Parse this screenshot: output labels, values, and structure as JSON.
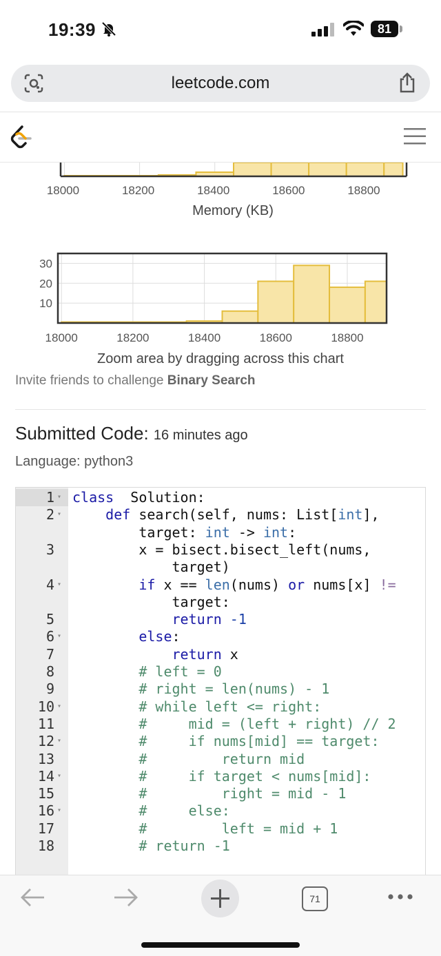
{
  "status_bar": {
    "time": "19:39",
    "battery": "81"
  },
  "browser": {
    "url": "leetcode.com",
    "tab_count": "71"
  },
  "memory_chart": {
    "x_ticks": [
      "18000",
      "18200",
      "18400",
      "18600",
      "18800"
    ],
    "x_label": "Memory (KB)"
  },
  "chart_data": [
    {
      "type": "bar",
      "xlabel": "Memory (KB)",
      "x_ticks": [
        18000,
        18200,
        18400,
        18600,
        18800
      ],
      "partial": true,
      "note_visible": "top portion cropped",
      "bin_edges": [
        18000,
        18100,
        18250,
        18350,
        18450,
        18550,
        18650,
        18750,
        18850,
        18900
      ],
      "values": [
        1,
        1,
        2,
        6,
        30,
        30,
        30,
        30,
        30
      ]
    },
    {
      "type": "bar",
      "x_ticks": [
        18000,
        18200,
        18400,
        18600,
        18800
      ],
      "y_ticks": [
        10,
        20,
        30
      ],
      "xlim": [
        17990,
        18910
      ],
      "ylim": [
        0,
        35
      ],
      "bin_edges": [
        18000,
        18100,
        18250,
        18350,
        18450,
        18550,
        18650,
        18750,
        18850,
        18910
      ],
      "values": [
        0.5,
        0.5,
        0.5,
        1,
        6,
        21,
        29,
        18,
        21
      ],
      "caption": "Zoom area by dragging across this chart"
    }
  ],
  "invite": {
    "prefix": "Invite friends to challenge ",
    "topic": "Binary Search"
  },
  "submission": {
    "title": "Submitted Code:",
    "ago": "16 minutes ago",
    "language": "Language: python3"
  },
  "code_lines": [
    {
      "n": "1",
      "fold": true
    },
    {
      "n": "2",
      "fold": true
    },
    {
      "n": "",
      "fold": false
    },
    {
      "n": "3",
      "fold": false
    },
    {
      "n": "",
      "fold": false
    },
    {
      "n": "4",
      "fold": true
    },
    {
      "n": "",
      "fold": false
    },
    {
      "n": "5",
      "fold": false
    },
    {
      "n": "6",
      "fold": true
    },
    {
      "n": "7",
      "fold": false
    },
    {
      "n": "8",
      "fold": false
    },
    {
      "n": "9",
      "fold": false
    },
    {
      "n": "10",
      "fold": true
    },
    {
      "n": "11",
      "fold": false
    },
    {
      "n": "12",
      "fold": true
    },
    {
      "n": "13",
      "fold": false
    },
    {
      "n": "14",
      "fold": true
    },
    {
      "n": "15",
      "fold": false
    },
    {
      "n": "16",
      "fold": true
    },
    {
      "n": "17",
      "fold": false
    },
    {
      "n": "18",
      "fold": false
    }
  ],
  "code_tokens": [
    [
      [
        "kw",
        "class"
      ],
      [
        "",
        "  Solution:"
      ]
    ],
    [
      [
        "",
        "    "
      ],
      [
        "kw",
        "def"
      ],
      [
        "",
        " search(self, nums: List["
      ],
      [
        "ty",
        "int"
      ],
      [
        "",
        "],"
      ]
    ],
    [
      [
        "",
        "        target: "
      ],
      [
        "ty",
        "int"
      ],
      [
        "",
        " -> "
      ],
      [
        "ty",
        "int"
      ],
      [
        "",
        ":"
      ]
    ],
    [
      [
        "",
        "        x = bisect.bisect_left(nums,"
      ]
    ],
    [
      [
        "",
        "            target)"
      ]
    ],
    [
      [
        "",
        "        "
      ],
      [
        "kw",
        "if"
      ],
      [
        "",
        " x == "
      ],
      [
        "bi",
        "len"
      ],
      [
        "",
        "(nums) "
      ],
      [
        "kw",
        "or"
      ],
      [
        "",
        " nums[x] "
      ],
      [
        "op",
        "!="
      ]
    ],
    [
      [
        "",
        "            target:"
      ]
    ],
    [
      [
        "",
        "            "
      ],
      [
        "kw",
        "return"
      ],
      [
        "",
        " "
      ],
      [
        "num",
        "-1"
      ]
    ],
    [
      [
        "",
        "        "
      ],
      [
        "kw",
        "else"
      ],
      [
        "",
        ":"
      ]
    ],
    [
      [
        "",
        "            "
      ],
      [
        "kw",
        "return"
      ],
      [
        "",
        " x"
      ]
    ],
    [
      [
        "cm",
        "        # left = 0"
      ]
    ],
    [
      [
        "cm",
        "        # right = len(nums) - 1"
      ]
    ],
    [
      [
        "cm",
        "        # while left <= right:"
      ]
    ],
    [
      [
        "cm",
        "        #     mid = (left + right) // 2"
      ]
    ],
    [
      [
        "cm",
        "        #     if nums[mid] == target:"
      ]
    ],
    [
      [
        "cm",
        "        #         return mid"
      ]
    ],
    [
      [
        "cm",
        "        #     if target < nums[mid]:"
      ]
    ],
    [
      [
        "cm",
        "        #         right = mid - 1"
      ]
    ],
    [
      [
        "cm",
        "        #     else:"
      ]
    ],
    [
      [
        "cm",
        "        #         left = mid + 1"
      ]
    ],
    [
      [
        "cm",
        "        # return -1"
      ]
    ]
  ]
}
